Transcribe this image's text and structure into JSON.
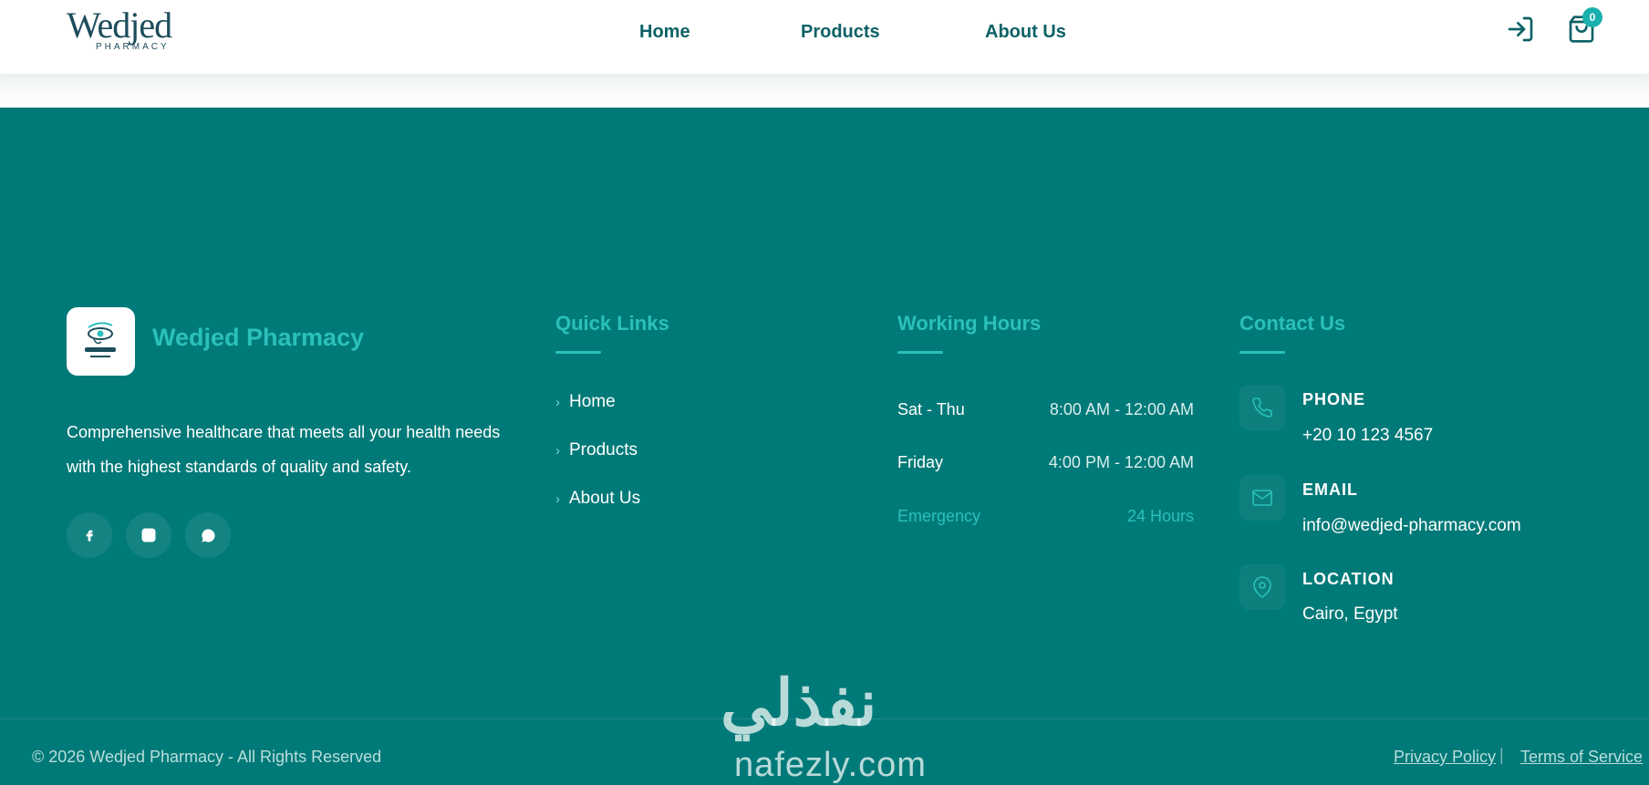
{
  "header": {
    "logo_word": "Wedjed",
    "logo_sub": "PHARMACY",
    "nav": [
      "Home",
      "Products",
      "About Us"
    ],
    "cart_count": "0",
    "icons": [
      "login-icon",
      "cart-icon"
    ]
  },
  "footer": {
    "brand": {
      "name": "Wedjed Pharmacy",
      "description": "Comprehensive healthcare that meets all your health needs with the highest standards of quality and safety.",
      "social_icons": [
        "facebook-icon",
        "instagram-icon",
        "whatsapp-icon"
      ]
    },
    "quick_links": {
      "title": "Quick Links",
      "items": [
        "Home",
        "Products",
        "About Us"
      ]
    },
    "working_hours": {
      "title": "Working Hours",
      "rows": [
        {
          "day": "Sat - Thu",
          "time": "8:00 AM - 12:00 AM"
        },
        {
          "day": "Friday",
          "time": "4:00 PM - 12:00 AM"
        },
        {
          "day": "Emergency",
          "time": "24 Hours"
        }
      ]
    },
    "contact": {
      "title": "Contact Us",
      "items": [
        {
          "label": "PHONE",
          "value": "+20 10 123 4567",
          "icon": "phone-icon"
        },
        {
          "label": "EMAIL",
          "value": "info@wedjed-pharmacy.com",
          "icon": "email-icon"
        },
        {
          "label": "LOCATION",
          "value": "Cairo, Egypt",
          "icon": "location-icon"
        }
      ]
    },
    "copyright": "© 2026 Wedjed Pharmacy - All Rights Reserved",
    "legal": [
      "Privacy Policy",
      "Terms of Service"
    ],
    "legal_separator": "|"
  },
  "watermark": {
    "arabic": "نفذلي",
    "latin": "nafezly.com"
  },
  "colors": {
    "footer_bg": "#007a78",
    "accent": "#2bc0bb",
    "nav_text": "#0d6166",
    "logo": "#1d4d5c"
  }
}
